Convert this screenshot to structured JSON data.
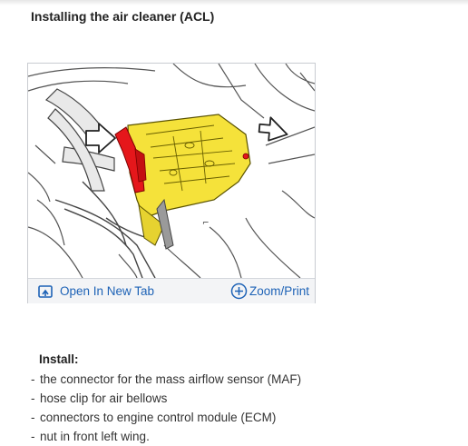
{
  "page": {
    "heading": "Installing the air cleaner (ACL)"
  },
  "figure": {
    "callout_label": "⌐",
    "toolbar": {
      "open_label": "Open In New Tab",
      "open_icon": "open-in-new-tab-icon",
      "zoom_label": "Zoom/Print",
      "zoom_icon": "plus-circle-icon"
    },
    "colors": {
      "link": "#1d62b6",
      "highlight_yellow": "#f5e23a",
      "highlight_red": "#e5171b"
    }
  },
  "instructions": {
    "title": "Install:",
    "bullet": "-",
    "steps": [
      "the connector for the mass airflow sensor (MAF)",
      "hose clip for air bellows",
      "connectors to engine control module (ECM)",
      "nut in front left wing."
    ]
  }
}
